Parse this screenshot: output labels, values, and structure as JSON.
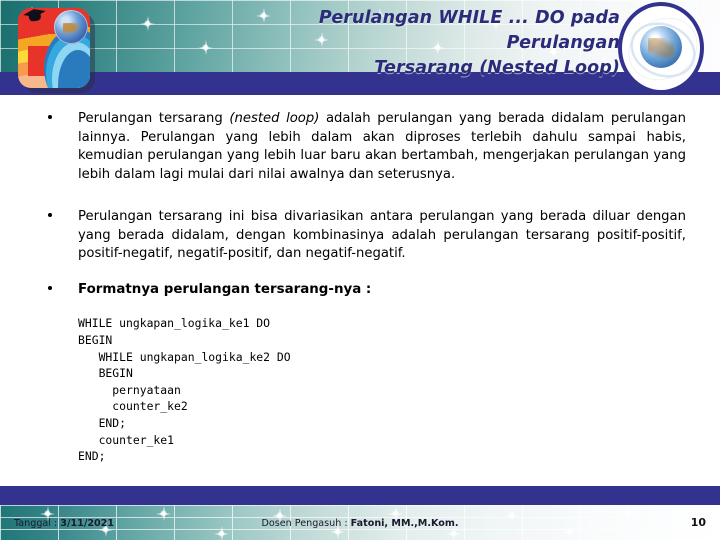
{
  "slide": {
    "header": {
      "title_line1": "Perulangan WHILE ... DO pada Perulangan",
      "title_line2": "Tersarang (Nested Loop)",
      "logo_name": "bina-darma-logo",
      "medallion_name": "globe-medallion",
      "band_color": "#33338f",
      "title_color": "#2b2b7a",
      "gradient_start": "#1a6e6e",
      "gradient_end": "#fdfdfe"
    },
    "bullets": [
      {
        "id": "bullet-1",
        "marker": "•",
        "segments": [
          {
            "text": "Perulangan tersarang ",
            "italic": false
          },
          {
            "text": "(nested loop)",
            "italic": true
          },
          {
            "text": " adalah perulangan yang berada didalam perulangan lainnya. Perulangan yang lebih dalam akan diproses terlebih dahulu sampai habis, kemudian perulangan yang lebih luar baru akan bertambah, mengerjakan perulangan yang lebih dalam lagi mulai dari nilai awalnya dan seterusnya.",
            "italic": false
          }
        ]
      },
      {
        "id": "bullet-2",
        "marker": "•",
        "segments": [
          {
            "text": "Perulangan tersarang ini bisa divariasikan antara perulangan yang berada diluar dengan yang berada didalam, dengan kombinasinya adalah perulangan tersarang positif-positif, positif-negatif, negatif-positif, dan negatif-negatif.",
            "italic": false
          }
        ]
      },
      {
        "id": "bullet-3",
        "marker": "•",
        "bold": true,
        "segments": [
          {
            "text": "Formatnya perulangan tersarang-nya :",
            "italic": false
          }
        ]
      }
    ],
    "code_block": "WHILE ungkapan_logika_ke1 DO\nBEGIN\n   WHILE ungkapan_logika_ke2 DO\n   BEGIN\n     pernyataan\n     counter_ke2\n   END;\n   counter_ke1\nEND;",
    "footer": {
      "date_label": "Tanggal : ",
      "date_value": "3/11/2021",
      "lecturer_label": "Dosen Pengasuh : ",
      "lecturer_value": "Fatoni, MM.,M.Kom.",
      "page_number": "10"
    }
  }
}
